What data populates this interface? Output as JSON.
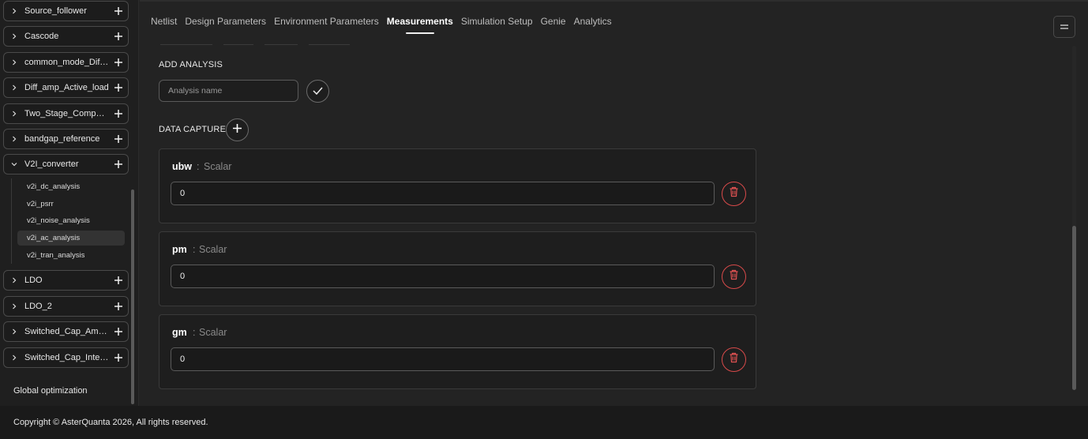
{
  "sidebar": {
    "groups": [
      {
        "label": "Source_follower",
        "expanded": false
      },
      {
        "label": "Cascode",
        "expanded": false
      },
      {
        "label": "common_mode_Diffa...",
        "expanded": false
      },
      {
        "label": "Diff_amp_Active_load",
        "expanded": false
      },
      {
        "label": "Two_Stage_Compara...",
        "expanded": false
      },
      {
        "label": "bandgap_reference",
        "expanded": false
      },
      {
        "label": "V2I_converter",
        "expanded": true
      },
      {
        "label": "LDO",
        "expanded": false
      },
      {
        "label": "LDO_2",
        "expanded": false
      },
      {
        "label": "Switched_Cap_Ampli...",
        "expanded": false
      },
      {
        "label": "Switched_Cap_Integr...",
        "expanded": false
      }
    ],
    "v2i_children": [
      {
        "label": "v2i_dc_analysis",
        "active": false
      },
      {
        "label": "v2i_psrr",
        "active": false
      },
      {
        "label": "v2i_noise_analysis",
        "active": false
      },
      {
        "label": "v2i_ac_analysis",
        "active": true
      },
      {
        "label": "v2i_tran_analysis",
        "active": false
      }
    ],
    "global_optimization": "Global optimization"
  },
  "topnav": {
    "tabs": [
      {
        "label": "Netlist",
        "active": false
      },
      {
        "label": "Design Parameters",
        "active": false
      },
      {
        "label": "Environment Parameters",
        "active": false
      },
      {
        "label": "Measurements",
        "active": true
      },
      {
        "label": "Simulation Setup",
        "active": false
      },
      {
        "label": "Genie",
        "active": false
      },
      {
        "label": "Analytics",
        "active": false
      }
    ]
  },
  "main": {
    "add_analysis_label": "ADD ANALYSIS",
    "analysis_placeholder": "Analysis name",
    "data_capture_label": "DATA CAPTURE",
    "measurements": [
      {
        "name": "ubw",
        "separator": ":",
        "type": "Scalar",
        "value": "0"
      },
      {
        "name": "pm",
        "separator": ":",
        "type": "Scalar",
        "value": "0"
      },
      {
        "name": "gm",
        "separator": ":",
        "type": "Scalar",
        "value": "0"
      }
    ]
  },
  "footer": {
    "copyright": "Copyright © AsterQuanta 2026, All rights reserved."
  },
  "colors": {
    "background": "#232323",
    "delete_accent": "#d84a4a",
    "active_tab": "#ffffff"
  }
}
